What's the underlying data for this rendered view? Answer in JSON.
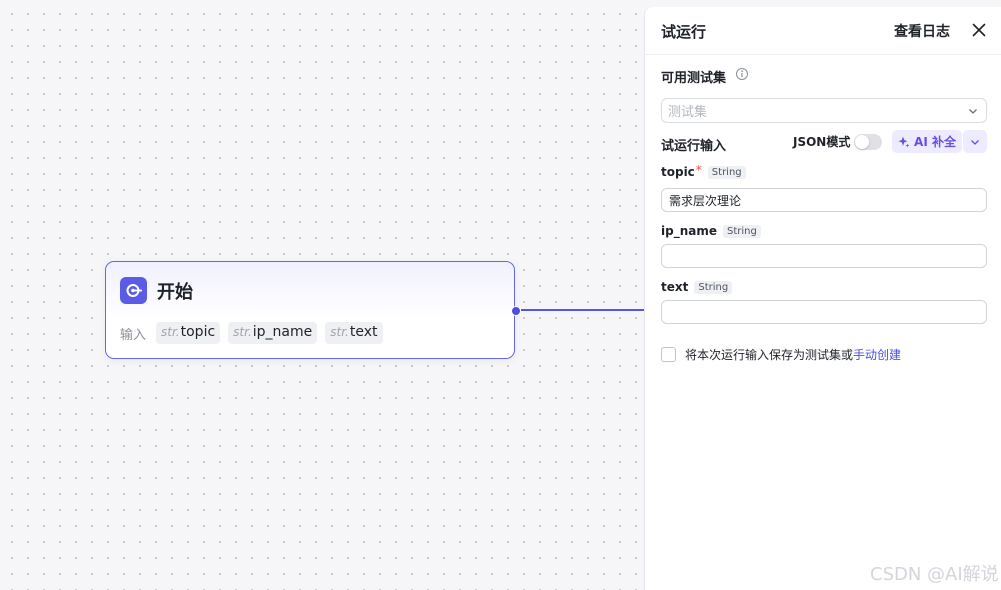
{
  "node": {
    "title": "开始",
    "inputs_label": "输入",
    "params": [
      {
        "type": "str.",
        "name": "topic"
      },
      {
        "type": "str.",
        "name": "ip_name"
      },
      {
        "type": "str.",
        "name": "text"
      }
    ]
  },
  "panel": {
    "title": "试运行",
    "log_label": "查看日志",
    "testset_label": "可用测试集",
    "testset_placeholder": "测试集",
    "run_input_label": "试运行输入",
    "json_mode_label": "JSON模式",
    "json_mode_on": false,
    "ai_label": "AI 补全",
    "fields": [
      {
        "name": "topic",
        "required": "*",
        "type": "String",
        "value": "需求层次理论"
      },
      {
        "name": "ip_name",
        "type": "String",
        "value": ""
      },
      {
        "name": "text",
        "type": "String",
        "value": ""
      }
    ],
    "save_text": "将本次运行输入保存为测试集或",
    "save_link": "手动创建"
  },
  "watermark": "CSDN @AI解说",
  "colors": {
    "accent": "#5a5ce6",
    "ai": "#6b4ce6",
    "required": "#f54a45"
  }
}
